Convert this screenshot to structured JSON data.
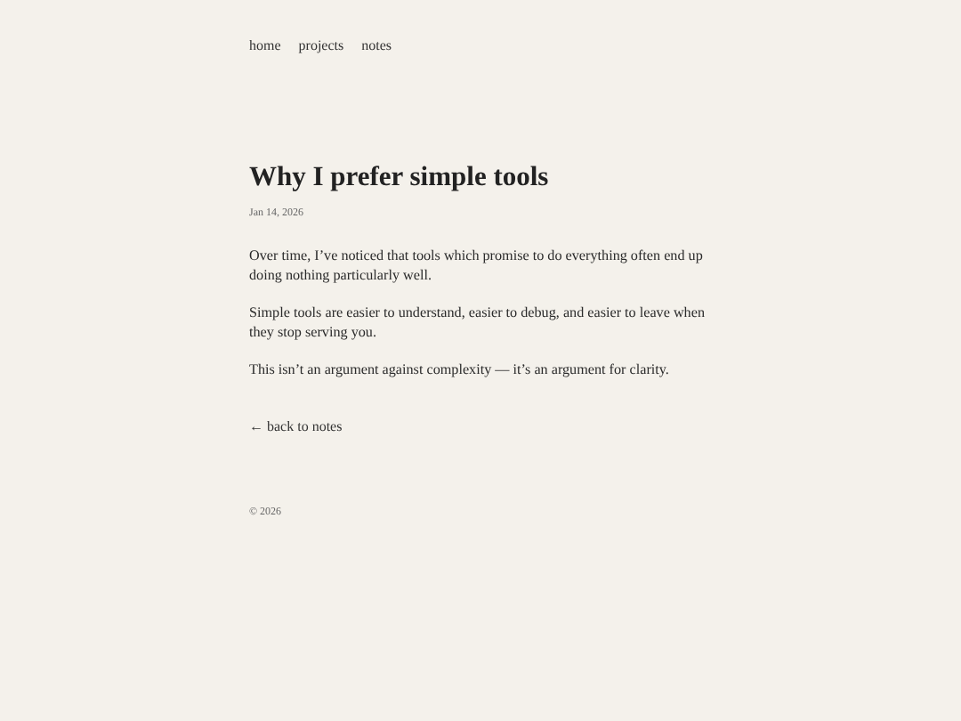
{
  "nav": [
    "home",
    "projects",
    "notes"
  ],
  "post": {
    "title": "Why I prefer simple tools",
    "date": "Jan 14, 2026",
    "paragraphs": [
      "Over time, I’ve noticed that tools which promise to do everything often end up doing nothing particularly well.",
      "Simple tools are easier to understand, easier to debug, and easier to leave when they stop serving you.",
      "This isn’t an argument against complexity — it’s an argument for clarity."
    ]
  },
  "back_link": "← back to notes",
  "footer": "© 2026"
}
